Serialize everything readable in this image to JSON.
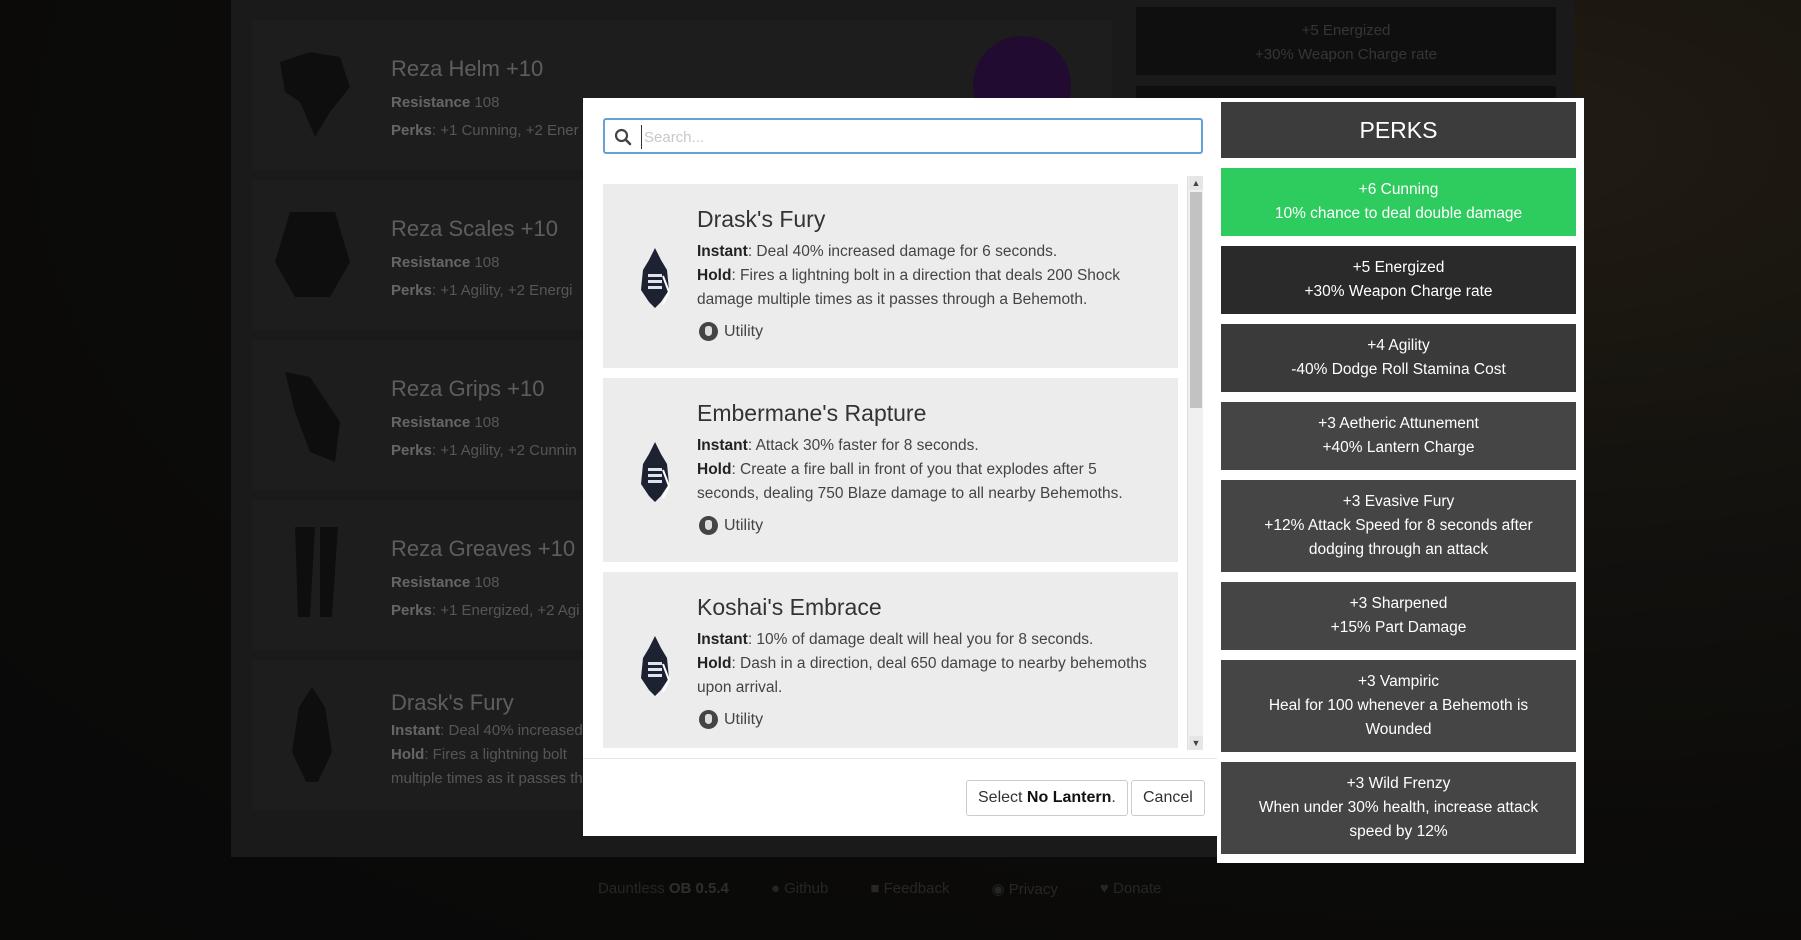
{
  "background": {
    "items": [
      {
        "name": "Reza Helm",
        "level": "+10",
        "resistance_label": "Resistance",
        "resistance_value": "108",
        "perks_label": "Perks",
        "perks_text": ": +1 Cunning, +2 Ener"
      },
      {
        "name": "Reza Scales",
        "level": "+10",
        "resistance_label": "Resistance",
        "resistance_value": "108",
        "perks_label": "Perks",
        "perks_text": ": +1 Agility, +2 Energi"
      },
      {
        "name": "Reza Grips",
        "level": "+10",
        "resistance_label": "Resistance",
        "resistance_value": "108",
        "perks_label": "Perks",
        "perks_text": ": +1 Agility, +2 Cunnin"
      },
      {
        "name": "Reza Greaves",
        "level": "+10",
        "resistance_label": "Resistance",
        "resistance_value": "108",
        "perks_label": "Perks",
        "perks_text": ": +1 Energized, +2 Agi"
      }
    ],
    "lantern": {
      "name": "Drask's Fury",
      "instant_label": "Instant",
      "instant_text": ": Deal 40% increased",
      "hold_label": "Hold",
      "hold_text": ": Fires a lightning bolt",
      "extra_text": "multiple times as it passes th"
    },
    "perk_top": {
      "title": "+5 Energized",
      "desc": "+30% Weapon Charge rate"
    }
  },
  "footer": {
    "brand": "Dauntless",
    "version": "OB 0.5.4",
    "links": [
      "Github",
      "Feedback",
      "Privacy",
      "Donate"
    ]
  },
  "modal": {
    "search_placeholder": "Search...",
    "lanterns": [
      {
        "name": "Drask's Fury",
        "instant_label": "Instant",
        "instant_text": ": Deal 40% increased damage for 6 seconds.",
        "hold_label": "Hold",
        "hold_text": ": Fires a lightning bolt in a direction that deals 200 Shock damage multiple times as it passes through a Behemoth.",
        "tag": "Utility"
      },
      {
        "name": "Embermane's Rapture",
        "instant_label": "Instant",
        "instant_text": ": Attack 30% faster for 8 seconds.",
        "hold_label": "Hold",
        "hold_text": ": Create a fire ball in front of you that explodes after 5 seconds, dealing 750 Blaze damage to all nearby Behemoths.",
        "tag": "Utility"
      },
      {
        "name": "Koshai's Embrace",
        "instant_label": "Instant",
        "instant_text": ": 10% of damage dealt will heal you for 8 seconds.",
        "hold_label": "Hold",
        "hold_text": ": Dash in a direction, deal 650 damage to nearby behemoths upon arrival.",
        "tag": "Utility"
      }
    ],
    "select_prefix": "Select ",
    "select_target": "No Lantern",
    "select_suffix": ".",
    "cancel_label": "Cancel"
  },
  "perks": {
    "heading": "PERKS",
    "items": [
      {
        "title": "+6 Cunning",
        "desc": "10% chance to deal double damage",
        "color": "#2ecc5f"
      },
      {
        "title": "+5 Energized",
        "desc": "+30% Weapon Charge rate",
        "color": "#2a2a2a"
      },
      {
        "title": "+4 Agility",
        "desc": "-40% Dodge Roll Stamina Cost",
        "color": "#3a3a3a"
      },
      {
        "title": "+3 Aetheric Attunement",
        "desc": "+40% Lantern Charge",
        "color": "#454545"
      },
      {
        "title": "+3 Evasive Fury",
        "desc": "+12% Attack Speed for 8 seconds after dodging through an attack",
        "color": "#454545"
      },
      {
        "title": "+3 Sharpened",
        "desc": "+15% Part Damage",
        "color": "#454545"
      },
      {
        "title": "+3 Vampiric",
        "desc": "Heal for 100 whenever a Behemoth is Wounded",
        "color": "#454545"
      },
      {
        "title": "+3 Wild Frenzy",
        "desc": "When under 30% health, increase attack speed by 12%",
        "color": "#454545"
      }
    ]
  }
}
